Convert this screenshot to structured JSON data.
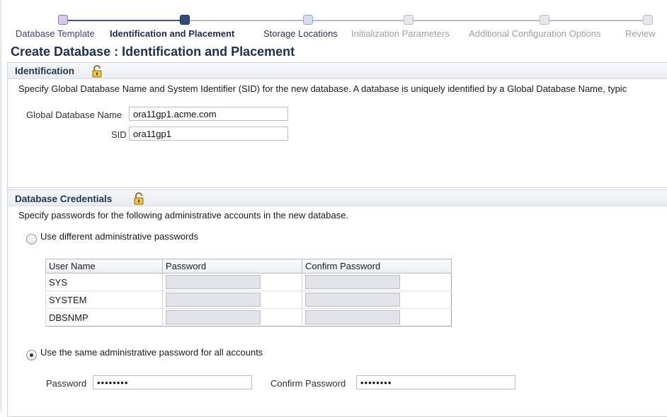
{
  "train": {
    "steps": [
      {
        "label": "Database Template",
        "state": "visited"
      },
      {
        "label": "Identification and Placement",
        "state": "current"
      },
      {
        "label": "Storage Locations",
        "state": "next"
      },
      {
        "label": "Initialization Parameters",
        "state": "future"
      },
      {
        "label": "Additional Configuration Options",
        "state": "future"
      },
      {
        "label": "Review",
        "state": "future"
      }
    ]
  },
  "page": {
    "title": "Create Database : Identification and Placement"
  },
  "identification": {
    "title": "Identification",
    "description": "Specify Global Database Name and System Identifier (SID) for the new database. A database is uniquely identified by a Global Database Name, typic",
    "global_db_name_label": "Global Database Name",
    "global_db_name_value": "ora11gp1.acme.com",
    "sid_label": "SID",
    "sid_value": "ora11gp1"
  },
  "credentials": {
    "title": "Database Credentials",
    "description": "Specify passwords for the following administrative accounts in the new database.",
    "option_different": {
      "label": "Use different administrative passwords",
      "selected": false
    },
    "table": {
      "headers": [
        "User Name",
        "Password",
        "Confirm Password"
      ],
      "rows": [
        {
          "user": "SYS"
        },
        {
          "user": "SYSTEM"
        },
        {
          "user": "DBSNMP"
        }
      ]
    },
    "option_same": {
      "label": "Use the same administrative password for all accounts",
      "selected": true
    },
    "password_label": "Password",
    "password_value": "••••••••",
    "confirm_label": "Confirm Password",
    "confirm_value": "••••••••"
  },
  "icons": {
    "lock": "lock-icon"
  }
}
